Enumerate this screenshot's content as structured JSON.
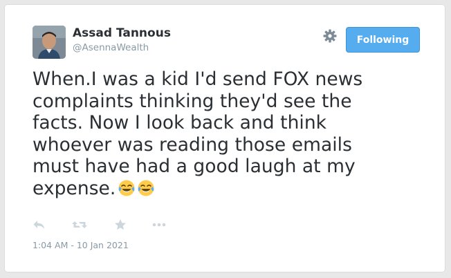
{
  "user": {
    "display_name": "Assad Tannous",
    "handle": "@AsennaWealth"
  },
  "follow_button": {
    "label": "Following",
    "color": "#55acee"
  },
  "tweet": {
    "lines": [
      "When.I was a kid I'd send FOX news",
      "complaints thinking they'd see the",
      "facts. Now I look back and think",
      "whoever was reading those emails",
      "must have had a good laugh at my",
      "expense."
    ],
    "emojis": [
      "face-with-tears-of-joy",
      "face-with-tears-of-joy"
    ],
    "timestamp": "1:04 AM - 10 Jan 2021"
  },
  "actions": {
    "icons": [
      "reply-icon",
      "retweet-icon",
      "favorite-icon",
      "more-icon"
    ]
  },
  "colors": {
    "text": "#292f33",
    "muted": "#8899a6",
    "icon": "#ccd6dd"
  }
}
